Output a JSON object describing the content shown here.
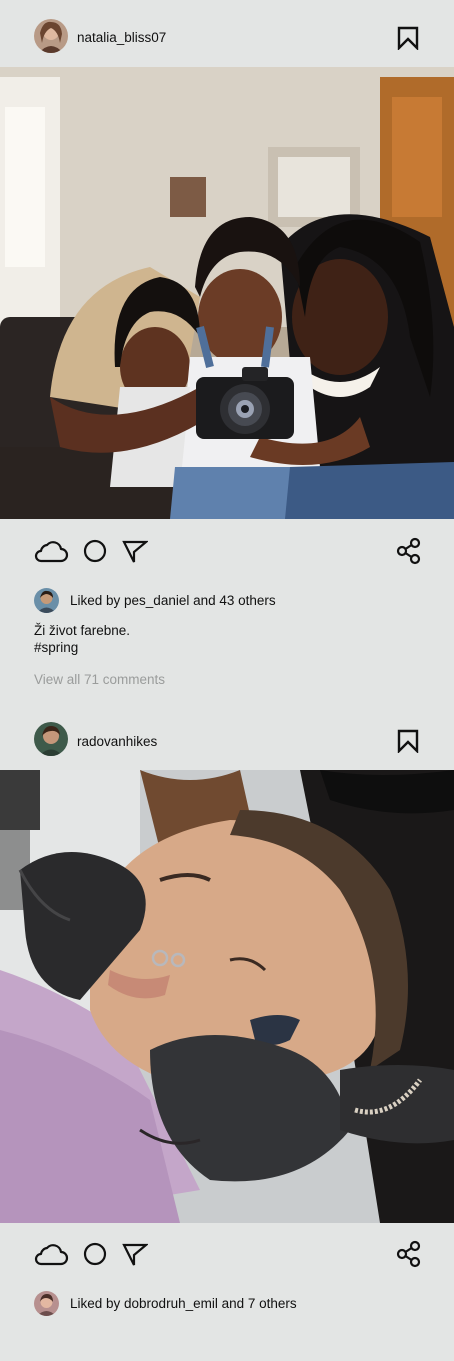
{
  "posts": [
    {
      "username": "natalia_bliss07",
      "liked_by": "pes_daniel",
      "liked_text": "Liked by pes_daniel and 43 others",
      "caption_line1": "Ži život farebne.",
      "caption_line2": "#spring",
      "view_comments": "View all 71 comments",
      "photo_desc_icon": "family-photo"
    },
    {
      "username": "radovanhikes",
      "liked_text": "Liked by dobrodruh_emil and 7 others",
      "photo_desc_icon": "piercing-photo"
    }
  ],
  "icons": {
    "like": "cloud-icon",
    "comment": "circle-icon",
    "send": "send-icon",
    "share": "share-icon",
    "save": "bookmark-icon"
  },
  "colors": {
    "background": "#e3e5e4",
    "text": "#111111",
    "muted": "#9a9c9b"
  }
}
